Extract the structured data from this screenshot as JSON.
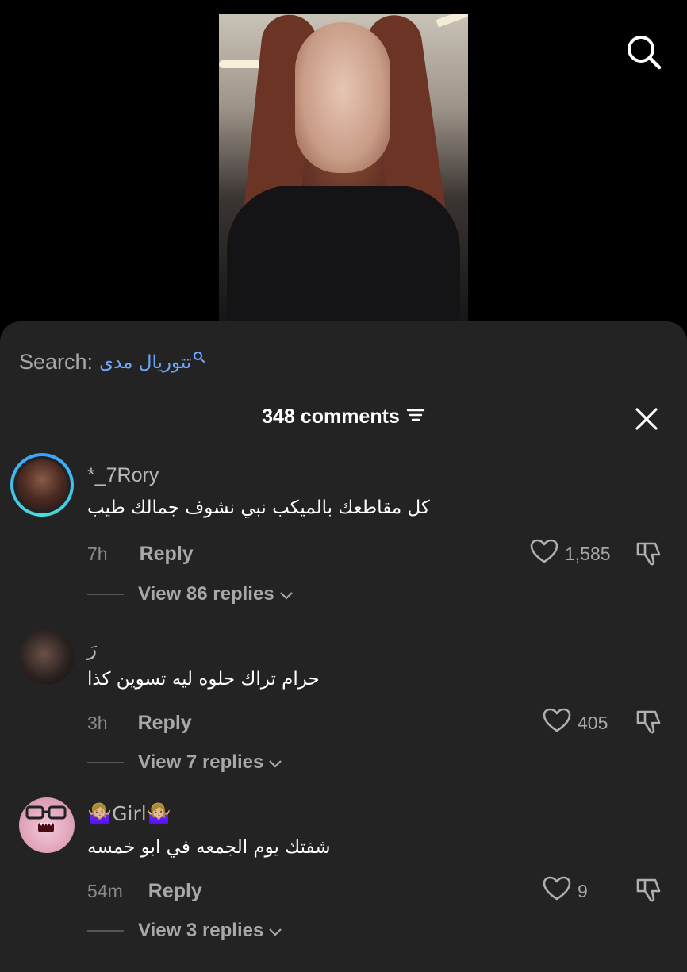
{
  "sheet": {
    "search_label": "Search:",
    "search_term": "تتوريال مدى",
    "comment_count": "348 comments"
  },
  "icons": {
    "search": "search-icon",
    "close": "close-icon",
    "sort": "sort-icon",
    "heart": "heart-icon",
    "dislike": "dislike-icon",
    "chevron": "chevron-down-icon"
  },
  "comments": [
    {
      "username": "*_7Rory",
      "text": "كل مقاطعك بالميكب نبي نشوف جمالك طيب",
      "time": "7h",
      "reply_label": "Reply",
      "likes": "1,585",
      "view_replies": "View 86 replies"
    },
    {
      "username": "رَ",
      "text": "حرام تراك حلوه ليه تسوين كذا",
      "time": "3h",
      "reply_label": "Reply",
      "likes": "405",
      "view_replies": "View 7 replies"
    },
    {
      "username": "🤷🏼‍♀️Girl🤷🏼‍♀️",
      "text": "شفتك يوم الجمعه في ابو خمسه",
      "time": "54m",
      "reply_label": "Reply",
      "likes": "9",
      "view_replies": "View 3 replies"
    }
  ]
}
